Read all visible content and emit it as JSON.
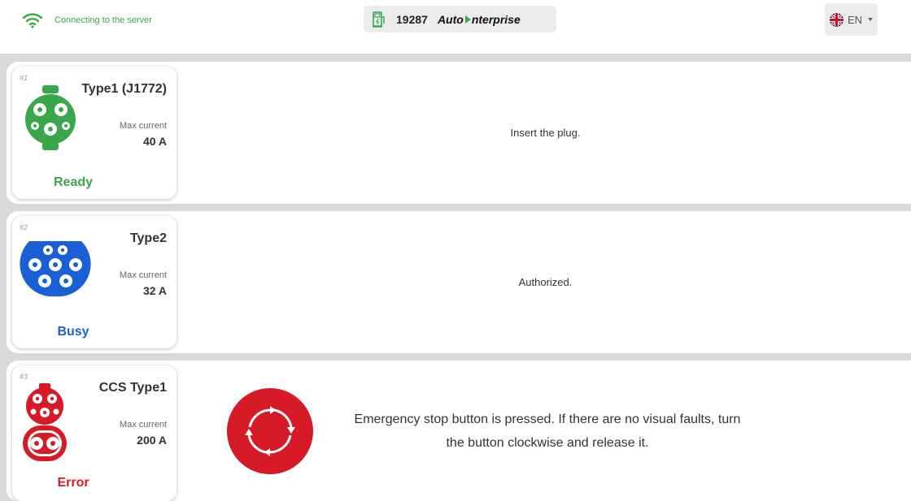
{
  "header": {
    "connection_text": "Connecting to the server",
    "station_id": "19287",
    "brand_part1": "Auto",
    "brand_part2": "nterprise",
    "language": "EN"
  },
  "connectors": [
    {
      "number": "#1",
      "type": "Type1 (J1772)",
      "max_current_label": "Max current",
      "max_current": "40 A",
      "status": "Ready",
      "status_color": "#3aa84a",
      "icon_color": "#3aa84a",
      "message": "Insert the plug."
    },
    {
      "number": "#2",
      "type": "Type2",
      "max_current_label": "Max current",
      "max_current": "32 A",
      "status": "Busy",
      "status_color": "#1a5fd6",
      "icon_color": "#1a5fd6",
      "message": "Authorized."
    },
    {
      "number": "#3",
      "type": "CCS Type1",
      "max_current_label": "Max current",
      "max_current": "200 A",
      "status": "Error",
      "status_color": "#d61a26",
      "icon_color": "#d61a26",
      "message": "Emergency stop button is pressed. If there are no visual faults, turn the button clockwise and release it."
    }
  ],
  "icons": {
    "connection": "wifi-icon",
    "station": "charging-station-icon",
    "language": "uk-flag-icon",
    "connector_1": "type1-plug-icon",
    "connector_2": "type2-plug-icon",
    "connector_3": "ccs-type1-plug-icon",
    "error": "emergency-stop-icon"
  }
}
